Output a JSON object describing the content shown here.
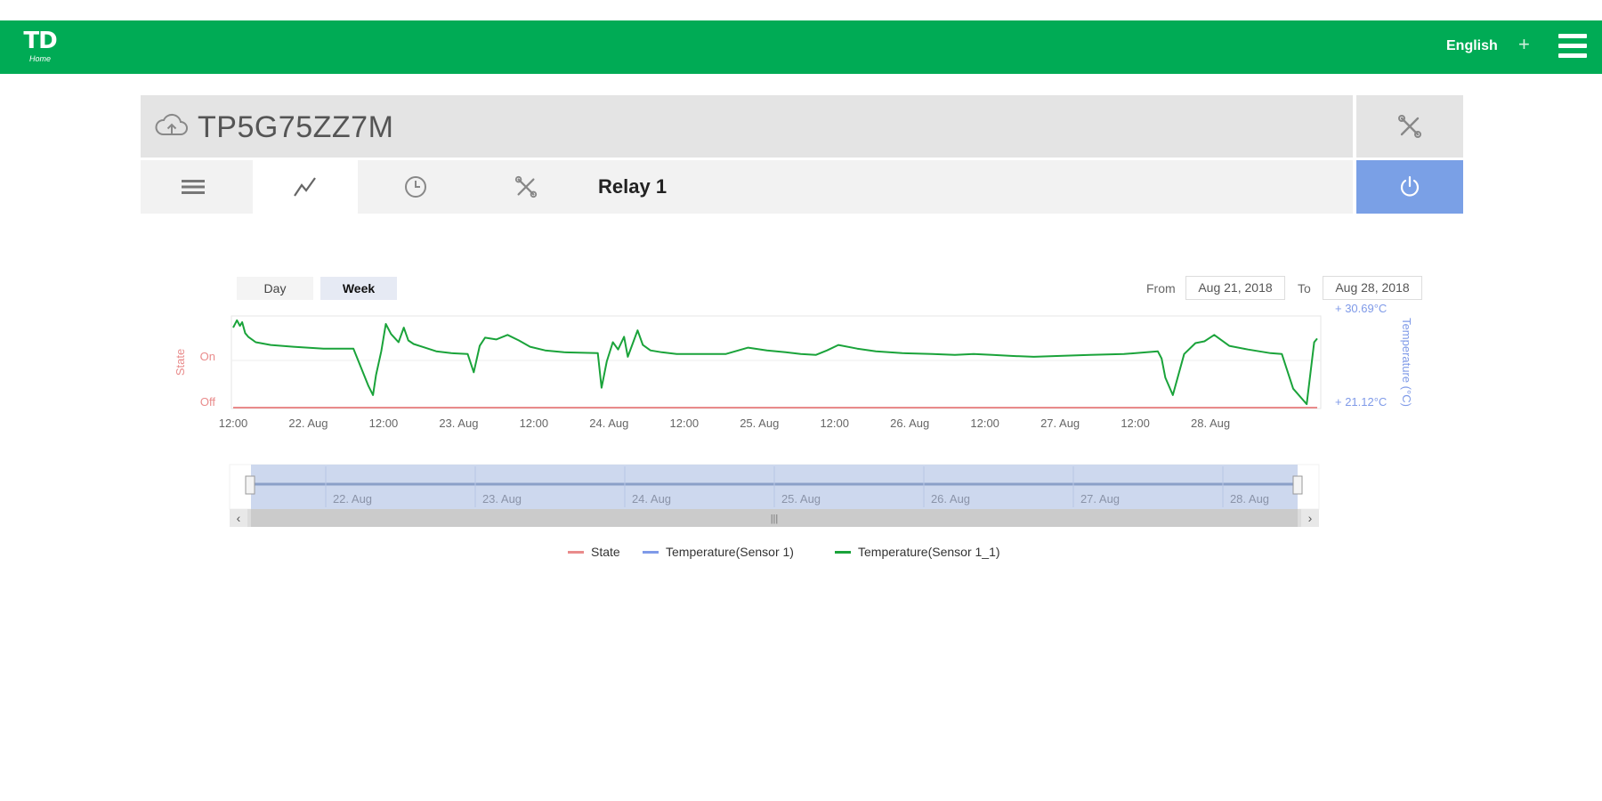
{
  "header": {
    "logo_text": "TD",
    "logo_sub": "Home",
    "language": "English",
    "add_symbol": "+",
    "brand_color": "#00ab55"
  },
  "device": {
    "id": "TP5G75ZZ7M",
    "relay_name": "Relay 1",
    "tabs": [
      {
        "icon": "list-icon"
      },
      {
        "icon": "chart-line-icon",
        "active": true
      },
      {
        "icon": "clock-icon"
      },
      {
        "icon": "tools-icon"
      }
    ],
    "power_color": "#7aa0e6"
  },
  "range": {
    "day_label": "Day",
    "week_label": "Week",
    "selected": "Week",
    "from_label": "From",
    "from_value": "Aug 21, 2018",
    "to_label": "To",
    "to_value": "Aug 28, 2018"
  },
  "chart_data": {
    "type": "line",
    "left_axis_title": "State",
    "left_ticks": [
      "On",
      "Off"
    ],
    "right_axis_title": "Temperature (°C)",
    "right_ticks": [
      "+ 30.69°C",
      "+ 21.12°C"
    ],
    "x_ticks": [
      "12:00",
      "22. Aug",
      "12:00",
      "23. Aug",
      "12:00",
      "24. Aug",
      "12:00",
      "25. Aug",
      "12:00",
      "26. Aug",
      "12:00",
      "27. Aug",
      "12:00",
      "28. Aug"
    ],
    "navigator_ticks": [
      "22. Aug",
      "23. Aug",
      "24. Aug",
      "25. Aug",
      "26. Aug",
      "27. Aug",
      "28. Aug"
    ],
    "colors": {
      "state": "#e98b8b",
      "sensor1": "#7f9ae8",
      "sensor1_1": "#1aa33a"
    },
    "series": [
      {
        "name": "State",
        "x": [
          0,
          7
        ],
        "y": [
          0,
          0
        ]
      },
      {
        "name": "Temperature(Sensor 1)",
        "x": [],
        "y": []
      },
      {
        "name": "Temperature(Sensor 1_1)",
        "x": [
          0.0,
          0.05,
          0.09,
          0.12,
          0.16,
          0.2,
          0.3,
          0.5,
          0.8,
          1.2,
          1.6,
          1.8,
          1.86,
          1.9,
          1.97,
          2.03,
          2.1,
          2.2,
          2.27,
          2.33,
          2.4,
          2.55,
          2.7,
          2.9,
          3.12,
          3.2,
          3.28,
          3.35,
          3.5,
          3.65,
          3.8,
          3.95,
          4.15,
          4.4,
          4.85,
          4.9,
          4.97,
          5.05,
          5.12,
          5.2,
          5.25,
          5.33,
          5.38,
          5.45,
          5.55,
          5.7,
          5.9,
          6.25,
          6.55,
          6.85,
          7.1,
          7.35,
          7.45,
          7.55,
          7.75,
          7.9,
          8.05,
          8.3,
          8.55,
          8.9,
          9.3,
          9.6,
          9.85,
          10.1,
          10.35,
          10.65,
          11.0,
          11.4,
          11.85,
          12.3,
          12.35,
          12.4,
          12.5,
          12.65,
          12.8,
          12.92,
          13.05,
          13.25,
          13.5,
          13.8,
          13.95,
          14.1,
          14.28,
          14.38,
          14.42
        ],
        "y": [
          29.8,
          30.6,
          30.0,
          30.4,
          29.2,
          28.8,
          28.2,
          27.9,
          27.7,
          27.5,
          27.5,
          23.4,
          22.4,
          24.6,
          27.2,
          30.2,
          29.1,
          28.2,
          29.8,
          28.4,
          28.0,
          27.6,
          27.2,
          27.0,
          26.9,
          24.9,
          27.8,
          28.7,
          28.5,
          29.0,
          28.4,
          27.7,
          27.3,
          27.1,
          27.0,
          23.2,
          26.1,
          28.2,
          27.4,
          28.8,
          26.6,
          28.4,
          29.5,
          27.9,
          27.3,
          27.1,
          26.9,
          26.9,
          26.9,
          27.6,
          27.3,
          27.1,
          27.0,
          26.9,
          26.8,
          27.3,
          27.9,
          27.5,
          27.2,
          27.0,
          26.9,
          26.8,
          26.9,
          26.8,
          26.7,
          26.6,
          26.7,
          26.8,
          26.9,
          27.2,
          26.4,
          24.3,
          22.4,
          26.9,
          28.1,
          28.3,
          29.0,
          27.8,
          27.4,
          27.0,
          26.9,
          23.1,
          21.4,
          28.2,
          28.6
        ]
      }
    ],
    "ylim_temp": [
      21.12,
      30.69
    ]
  },
  "navigator": {
    "left_arrow": "‹",
    "right_arrow": "›",
    "grip": "|||"
  }
}
